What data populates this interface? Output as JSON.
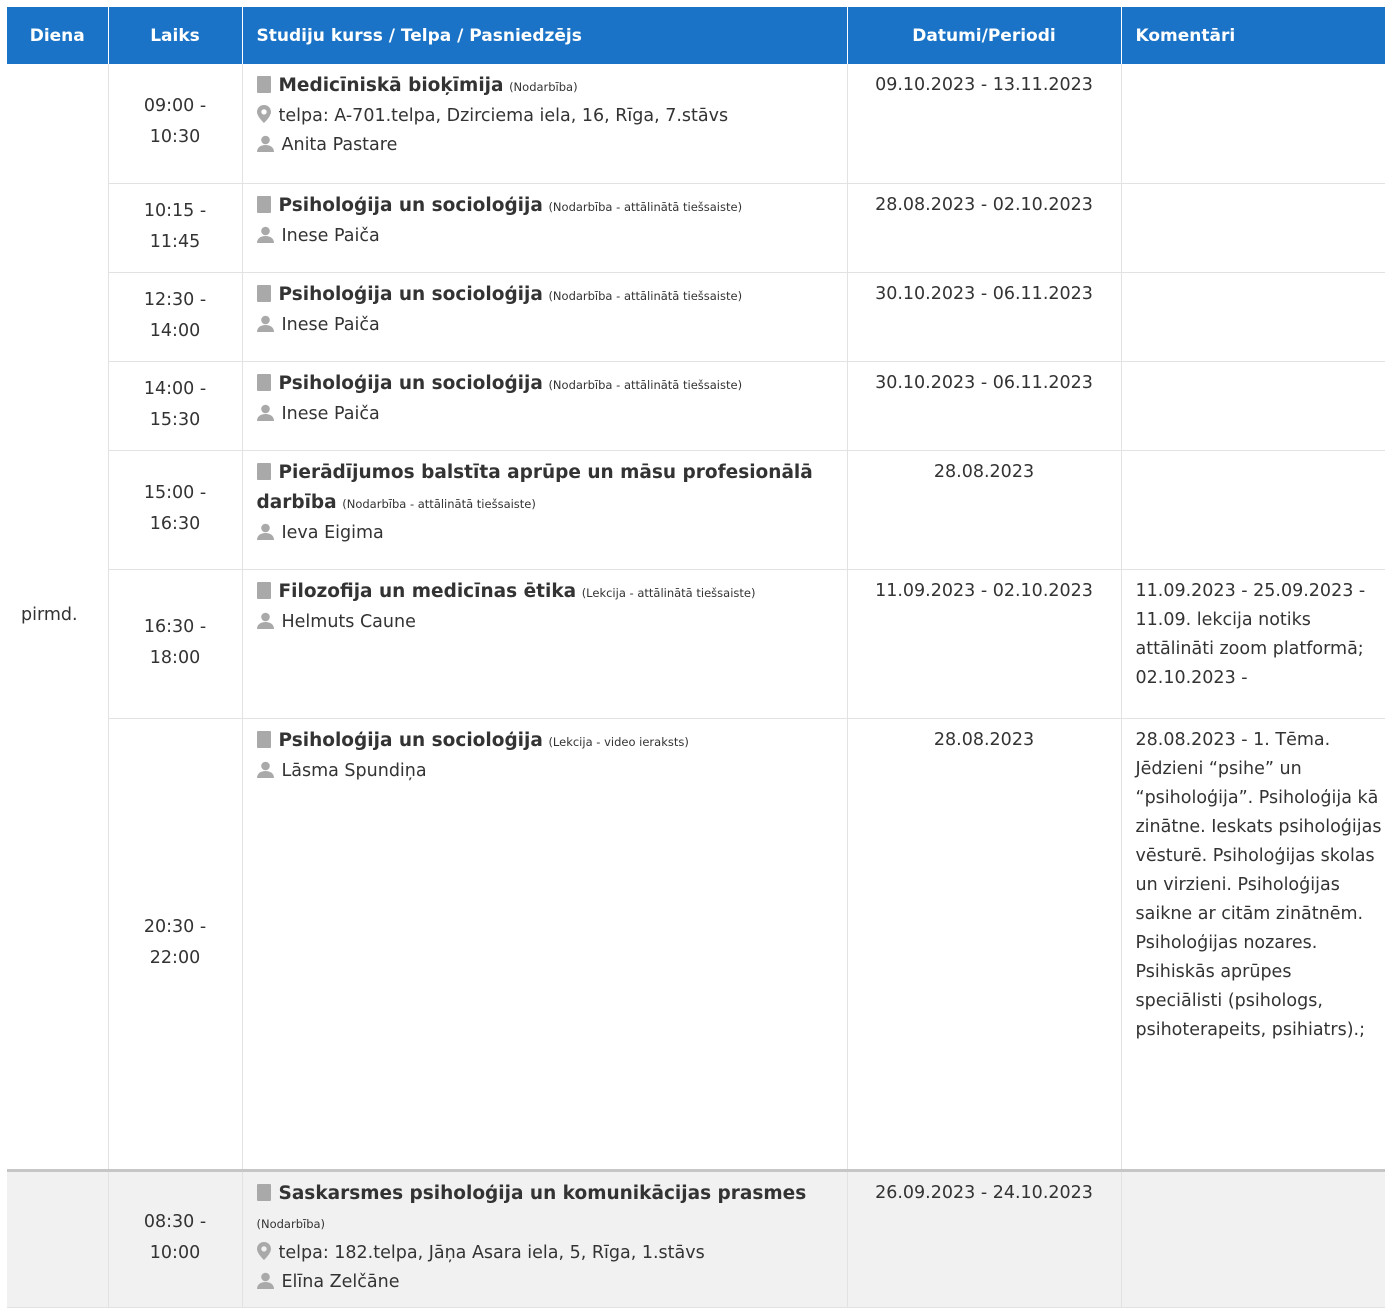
{
  "headers": {
    "day": "Diena",
    "time": "Laiks",
    "course": "Studiju kurss / Telpa / Pasniedzējs",
    "dates": "Datumi/Periodi",
    "comments": "Komentāri"
  },
  "days": {
    "monday": "pirmd.",
    "tuesday": ""
  },
  "rows": [
    {
      "time_start": "09:00 -",
      "time_end": "10:30",
      "course": "Medicīniskā bioķīmija",
      "type": "(Nodarbība)",
      "room": "telpa: A-701.telpa, Dzirciema iela, 16, Rīga, 7.stāvs",
      "lecturer": "Anita Pastare",
      "dates": "09.10.2023 - 13.11.2023",
      "comment": ""
    },
    {
      "time_start": "10:15 -",
      "time_end": "11:45",
      "course": "Psiholoģija un socioloģija",
      "type": "(Nodarbība - attālinātā tiešsaiste)",
      "lecturer": "Inese Paiča",
      "dates": "28.08.2023 - 02.10.2023",
      "comment": ""
    },
    {
      "time_start": "12:30 -",
      "time_end": "14:00",
      "course": "Psiholoģija un socioloģija",
      "type": "(Nodarbība - attālinātā tiešsaiste)",
      "lecturer": "Inese Paiča",
      "dates": "30.10.2023 - 06.11.2023",
      "comment": ""
    },
    {
      "time_start": "14:00 -",
      "time_end": "15:30",
      "course": "Psiholoģija un socioloģija",
      "type": "(Nodarbība - attālinātā tiešsaiste)",
      "lecturer": "Inese Paiča",
      "dates": "30.10.2023 - 06.11.2023",
      "comment": ""
    },
    {
      "time_start": "15:00 -",
      "time_end": "16:30",
      "course": "Pierādījumos balstīta aprūpe un māsu profesionālā darbība",
      "type": "(Nodarbība - attālinātā tiešsaiste)",
      "lecturer": "Ieva Eigima",
      "dates": "28.08.2023",
      "comment": ""
    },
    {
      "time_start": "16:30 -",
      "time_end": "18:00",
      "course": "Filozofija un medicīnas ētika",
      "type": "(Lekcija - attālinātā tiešsaiste)",
      "lecturer": "Helmuts Caune",
      "dates": "11.09.2023 - 02.10.2023",
      "comment": "11.09.2023 - 25.09.2023 - 11.09. lekcija notiks attālināti zoom platformā; 02.10.2023 -"
    },
    {
      "time_start": "20:30 -",
      "time_end": "22:00",
      "course": "Psiholoģija un socioloģija",
      "type": "(Lekcija - video ieraksts)",
      "lecturer": "Lāsma Spundiņa",
      "dates": "28.08.2023",
      "comment": "28.08.2023 - 1. Tēma. Jēdzieni “psihe” un “psiholoģija”. Psiholoģija kā zinātne. Ieskats psiholoģijas vēsturē. Psiholoģijas skolas un virzieni. Psiholoģijas saikne ar citām zinātnēm. Psiholoģijas nozares. Psihiskās aprūpes speciālisti (psihologs, psihoterapeits, psihiatrs).;"
    },
    {
      "time_start": "08:30 -",
      "time_end": "10:00",
      "course": "Saskarsmes psiholoģija un komunikācijas prasmes",
      "type": "(Nodarbība)",
      "room": "telpa: 182.telpa, Jāņa Asara iela, 5, Rīga, 1.stāvs",
      "lecturer": "Elīna Zelčāne",
      "dates": "26.09.2023 - 24.10.2023",
      "comment": ""
    }
  ],
  "icons": {
    "course": "book-icon",
    "room": "map-pin-icon",
    "lecturer": "user-icon",
    "icon_color": "#a9a9a9"
  },
  "colors": {
    "header_bg": "#1a73c6",
    "header_text": "#ffffff",
    "next_day_bg": "#f1f1f1"
  }
}
